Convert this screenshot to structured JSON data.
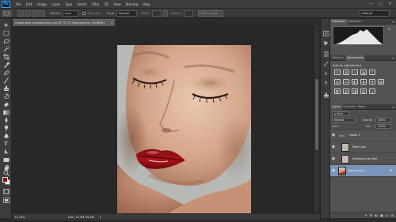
{
  "app": {
    "logo": "Ps"
  },
  "menu": [
    "File",
    "Edit",
    "Image",
    "Layer",
    "Type",
    "Select",
    "Filter",
    "3D",
    "View",
    "Window",
    "Help"
  ],
  "window_controls": [
    "—",
    "□",
    "✕"
  ],
  "options_bar": {
    "feather_label": "Feather:",
    "feather_value": "0 px",
    "anti_alias_label": "Anti-alias",
    "style_label": "Style:",
    "style_value": "Normal",
    "width_label": "Width:",
    "height_label": "Height:",
    "refine_edge": "Refine Edge...",
    "workspace": "Default"
  },
  "document": {
    "tab_title": "model-with-smashed-skin.psd @ 73,7% (Background, RGB/8#)",
    "zoom": "73,74%",
    "doc_info": "Doc: 17,9M/39,8M",
    "status_arrow": "▸"
  },
  "panels": {
    "histogram_tabs": [
      "Histogram",
      "Navigator"
    ],
    "adjustment_tabs": [
      "Libraries",
      "Adjustments"
    ],
    "add_adjustment": "Add an adjustment",
    "layers_tabs": [
      "Layers",
      "Channels",
      "Paths"
    ],
    "kind_value": "ρ Kind",
    "blend_mode": "Normal",
    "opacity_label": "Opacity:",
    "opacity_value": "100%",
    "lock_label": "Lock:",
    "fill_label": "Fill:",
    "fill_value": "100%",
    "layers": [
      {
        "name": "Group 1",
        "selected": false
      },
      {
        "name": "Patch tool",
        "selected": false
      },
      {
        "name": "Healing brush tool",
        "selected": false
      },
      {
        "name": "Background",
        "selected": true
      }
    ],
    "footer_icons": [
      "⚭",
      "fx",
      "◐",
      "▣",
      "▭",
      "⊞"
    ]
  },
  "colors": {
    "foreground": "#8c1111",
    "background": "#ffffff",
    "selection": "#7b94b8",
    "accent": "#31a8ff"
  }
}
